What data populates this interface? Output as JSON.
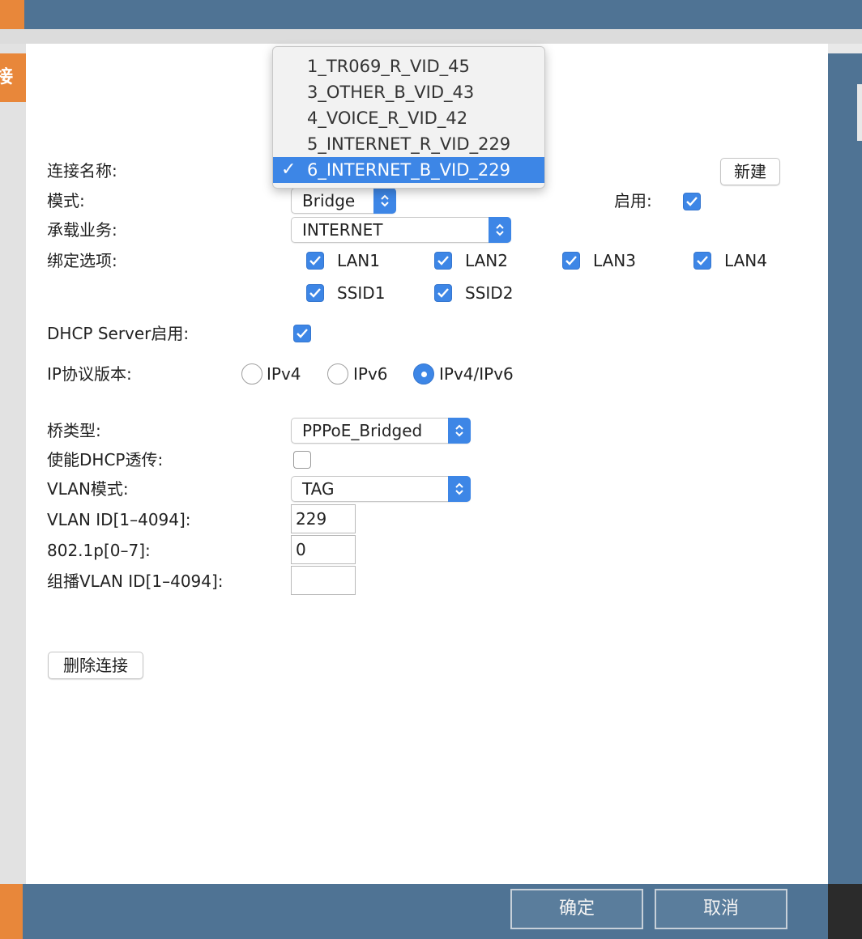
{
  "sidebar": {
    "tab_label": "接"
  },
  "form": {
    "connection_name_label": "连接名称:",
    "new_button": "新建",
    "mode_label": "模式:",
    "mode_value": "Bridge",
    "enable_label": "启用:",
    "service_label": "承载业务:",
    "service_value": "INTERNET",
    "binding_label": "绑定选项:",
    "bindings": [
      "LAN1",
      "LAN2",
      "LAN3",
      "LAN4",
      "SSID1",
      "SSID2"
    ],
    "dhcp_server_label": "DHCP Server启用:",
    "ip_version_label": "IP协议版本:",
    "ip_versions": [
      "IPv4",
      "IPv6",
      "IPv4/IPv6"
    ],
    "ip_version_selected": "IPv4/IPv6",
    "bridge_type_label": "桥类型:",
    "bridge_type_value": "PPPoE_Bridged",
    "dhcp_passthrough_label": "使能DHCP透传:",
    "vlan_mode_label": "VLAN模式:",
    "vlan_mode_value": "TAG",
    "vlan_id_label": "VLAN ID[1–4094]:",
    "vlan_id_value": "229",
    "priority_label": "802.1p[0–7]:",
    "priority_value": "0",
    "multicast_vlan_label": "组播VLAN ID[1–4094]:",
    "multicast_vlan_value": "",
    "delete_button": "删除连接"
  },
  "dropdown": {
    "options": [
      "1_TR069_R_VID_45",
      "3_OTHER_B_VID_43",
      "4_VOICE_R_VID_42",
      "5_INTERNET_R_VID_229",
      "6_INTERNET_B_VID_229"
    ],
    "selected": "6_INTERNET_B_VID_229",
    "check_glyph": "✓"
  },
  "footer": {
    "confirm_button": "确定",
    "cancel_button": "取消"
  },
  "colors": {
    "accent": "#3d86e6",
    "header": "#4f7394",
    "orange": "#e8873a"
  }
}
